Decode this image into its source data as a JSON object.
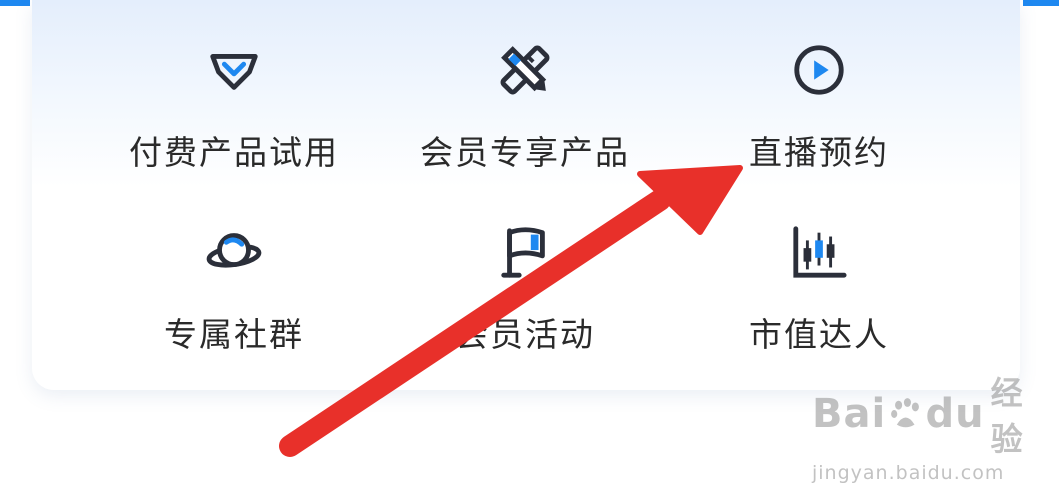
{
  "grid": {
    "items": [
      {
        "label": "付费产品试用",
        "icon": "diamond-icon"
      },
      {
        "label": "会员专享产品",
        "icon": "pencil-ruler-icon"
      },
      {
        "label": "直播预约",
        "icon": "play-circle-icon"
      },
      {
        "label": "专属社群",
        "icon": "planet-icon"
      },
      {
        "label": "会员活动",
        "icon": "flag-icon"
      },
      {
        "label": "市值达人",
        "icon": "candlestick-chart-icon"
      }
    ]
  },
  "watermark": {
    "brand_left": "Bai",
    "brand_right": "du",
    "brand_suffix": "经验",
    "url": "jingyan.baidu.com"
  },
  "colors": {
    "accent": "#1e88f0",
    "icon_dark": "#2b2f3a",
    "arrow": "#e8302a"
  }
}
